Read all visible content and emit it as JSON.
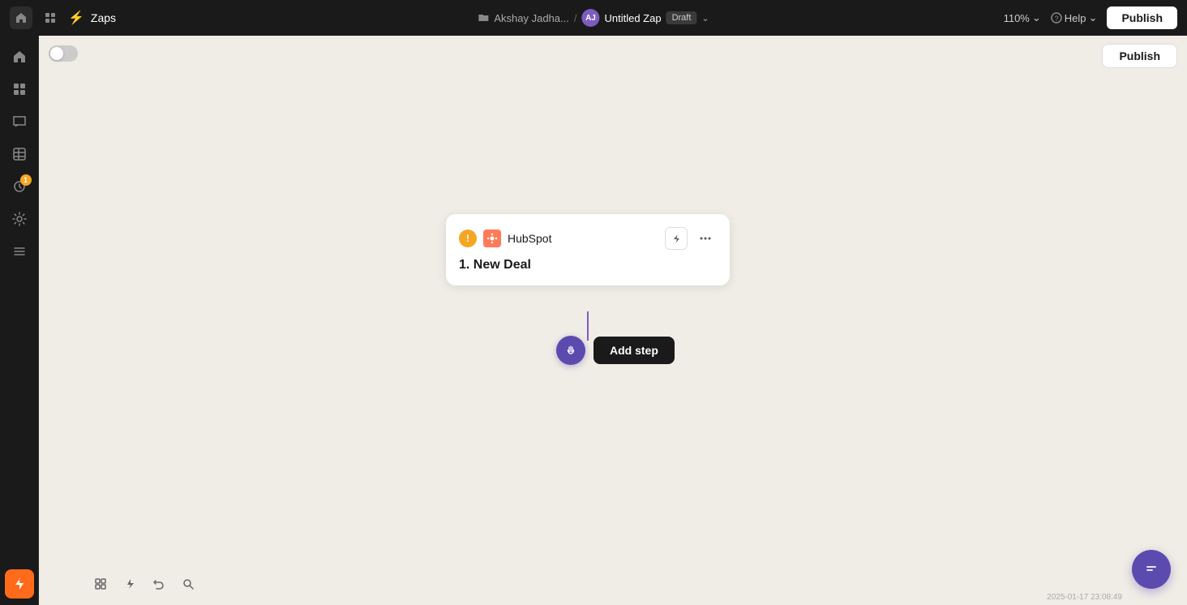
{
  "topbar": {
    "home_icon": "⌂",
    "grid_icon": "⊞",
    "zap_icon": "⚡",
    "zaps_label": "Zaps",
    "folder_icon": "📁",
    "breadcrumb_user": "Akshay Jadha...",
    "separator": "/",
    "avatar_initials": "AJ",
    "zap_name": "Untitled Zap",
    "draft_label": "Draft",
    "chevron_icon": "⌄",
    "zoom_label": "110%",
    "zoom_chevron": "⌄",
    "help_icon": "?",
    "help_label": "Help",
    "help_chevron": "⌄",
    "publish_label": "Publish"
  },
  "sidebar": {
    "items": [
      {
        "icon": "⌂",
        "label": "home",
        "active": false
      },
      {
        "icon": "⊞",
        "label": "apps",
        "active": false
      },
      {
        "icon": "💬",
        "label": "messages",
        "active": false
      },
      {
        "icon": "⊟",
        "label": "tables",
        "active": false
      },
      {
        "icon": "⏱",
        "label": "history",
        "active": false
      },
      {
        "icon": "⚙",
        "label": "settings",
        "active": false
      },
      {
        "icon": "☰",
        "label": "menu",
        "active": false
      }
    ],
    "badge_count": "1",
    "bottom_icon": "⚡"
  },
  "canvas": {
    "toggle_state": "off",
    "publish_label": "Publish"
  },
  "zap_node": {
    "warning_icon": "!",
    "app_name": "HubSpot",
    "app_logo": "HS",
    "lightning_icon": "⚡",
    "more_icon": "•••",
    "step_label": "1. New Deal"
  },
  "add_step": {
    "plus_icon": "✦",
    "button_label": "Add step"
  },
  "bottom_toolbar": {
    "grid_icon": "⊞",
    "bolt_icon": "⚡",
    "undo_icon": "↺",
    "search_icon": "🔍"
  },
  "chat": {
    "icon": "💬"
  },
  "timestamp": "2025-01-17 23:08:49"
}
